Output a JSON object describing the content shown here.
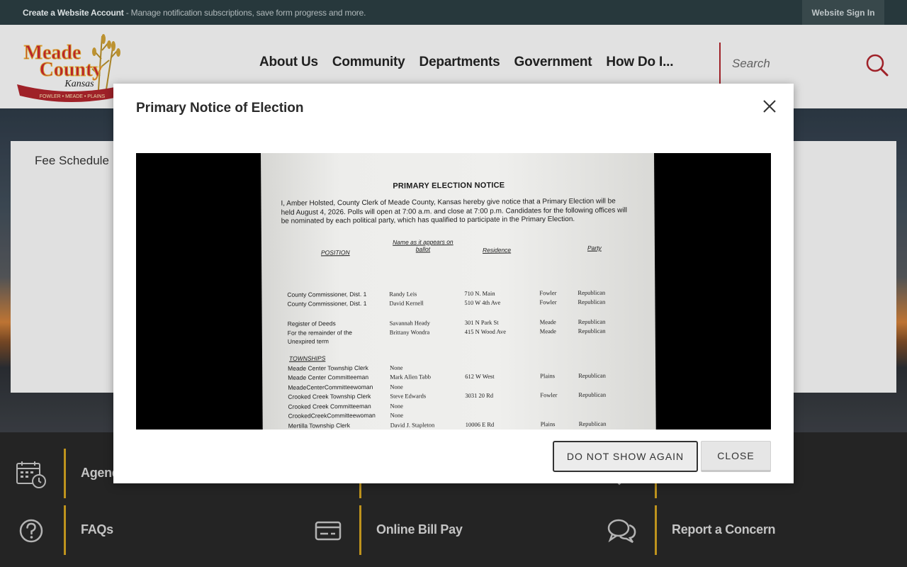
{
  "topbar": {
    "create_account": "Create a Website Account",
    "message": " - Manage notification subscriptions, save form progress and more.",
    "sign_in": "Website Sign In"
  },
  "logo": {
    "line1": "Meade",
    "line2": "County",
    "line3": "Kansas",
    "tagline": "FOWLER • MEADE • PLAINS"
  },
  "nav": [
    "About Us",
    "Community",
    "Departments",
    "Government",
    "How Do I..."
  ],
  "search": {
    "placeholder": "Search"
  },
  "content": {
    "fee_schedule": "Fee Schedule"
  },
  "quick_links": {
    "agendas": "Agendas",
    "faqs": "FAQs",
    "online_bill_pay": "Online Bill Pay",
    "report_concern": "Report a Concern"
  },
  "modal": {
    "title": "Primary Notice of Election",
    "buttons": {
      "do_not_show": "DO NOT SHOW AGAIN",
      "close": "CLOSE"
    },
    "notice": {
      "heading": "PRIMARY ELECTION NOTICE",
      "body": "I, Amber Holsted, County Clerk of Meade County, Kansas hereby give notice that a Primary Election will be held August 4, 2026. Polls will open at 7:00 a.m. and close at 7:00 p.m. Candidates for the following offices will be nominated by each political party, which has qualified to participate in the Primary Election.",
      "col_position": "POSITION",
      "col_name": "Name as it appears on ballot",
      "col_residence": "Residence",
      "col_party": "Party",
      "townships": "TOWNSHIPS",
      "rows": [
        {
          "position": "County Commissioner, Dist. 1",
          "name": "Randy Leis",
          "residence": "710 N. Main",
          "city": "Fowler",
          "party": "Republican"
        },
        {
          "position": "County Commissioner, Dist. 1",
          "name": "David Kernell",
          "residence": "510 W 4th Ave",
          "city": "Fowler",
          "party": "Republican"
        },
        {
          "position": "Register of Deeds",
          "name": "Savannah Heady",
          "residence": "301 N Park St",
          "city": "Meade",
          "party": "Republican"
        },
        {
          "position": "For the remainder of the",
          "name": "Brittany Wondra",
          "residence": "415 N Wood Ave",
          "city": "Meade",
          "party": "Republican"
        },
        {
          "position": "Unexpired term",
          "name": "",
          "residence": "",
          "city": "",
          "party": ""
        },
        {
          "position": "Meade Center Township Clerk",
          "name": "None",
          "residence": "",
          "city": "",
          "party": ""
        },
        {
          "position": "Meade Center Committeeman",
          "name": "Mark Allen Tabb",
          "residence": "612 W West",
          "city": "Plains",
          "party": "Republican"
        },
        {
          "position": "MeadeCenterCommitteewoman",
          "name": "None",
          "residence": "",
          "city": "",
          "party": ""
        },
        {
          "position": "Crooked Creek Township Clerk",
          "name": "Steve Edwards",
          "residence": "3031 20 Rd",
          "city": "Fowler",
          "party": "Republican"
        },
        {
          "position": "Crooked Creek Committeeman",
          "name": "None",
          "residence": "",
          "city": "",
          "party": ""
        },
        {
          "position": "CrookedCreekCommitteewoman",
          "name": "None",
          "residence": "",
          "city": "",
          "party": ""
        },
        {
          "position": "Mertilla Township Clerk",
          "name": "David J. Stapleton",
          "residence": "10006 E Rd",
          "city": "Plains",
          "party": "Republican"
        }
      ]
    }
  },
  "colors": {
    "accent_red": "#a8232b",
    "gold": "#c99b1f",
    "topbar": "#2a3c40"
  }
}
